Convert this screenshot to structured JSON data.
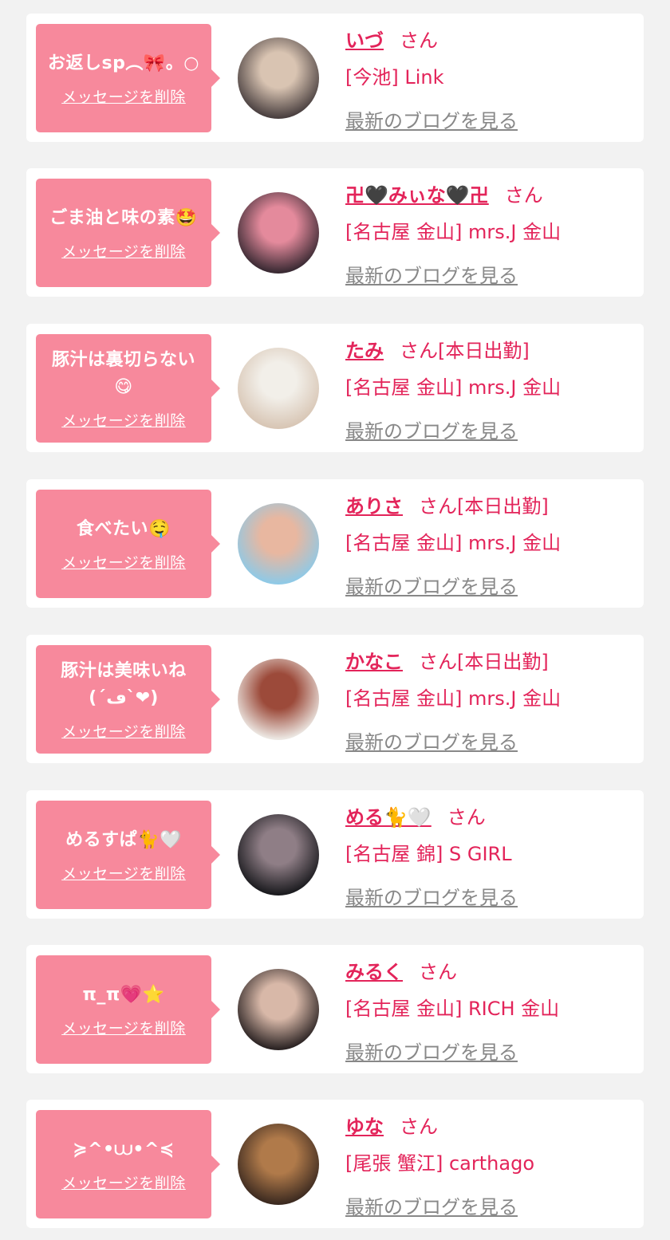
{
  "delete_label": "メッセージを削除",
  "blog_label": "最新のブログを見る",
  "san_label": "さん",
  "cards": [
    {
      "message": "お返しsp︵🎀。○",
      "name": "いづ",
      "suffix": "",
      "shop": "[今池] Link",
      "avatar_colors": [
        "#4a4040",
        "#d9c4b2"
      ]
    },
    {
      "message": "ごま油と味の素🤩",
      "name": "卍🖤みぃな🖤卍",
      "suffix": "",
      "shop": "[名古屋 金山] mrs.J 金山",
      "avatar_colors": [
        "#3a2a33",
        "#e48a9c"
      ]
    },
    {
      "message": "豚汁は裏切らない\n😋",
      "name": "たみ",
      "suffix": "[本日出勤]",
      "shop": "[名古屋 金山] mrs.J 金山",
      "avatar_colors": [
        "#d8c6b5",
        "#f2efe9"
      ]
    },
    {
      "message": "食べたい🤤",
      "name": "ありさ",
      "suffix": "[本日出勤]",
      "shop": "[名古屋 金山] mrs.J 金山",
      "avatar_colors": [
        "#8fc9e6",
        "#e8b7a0"
      ]
    },
    {
      "message": "豚汁は美味いね\n(´ڡ`❤)",
      "name": "かなこ",
      "suffix": "[本日出勤]",
      "shop": "[名古屋 金山] mrs.J 金山",
      "avatar_colors": [
        "#ece7e2",
        "#9c4a3a"
      ]
    },
    {
      "message": "めるすぱ🐈🤍",
      "name": "める🐈🤍",
      "suffix": "",
      "shop": "[名古屋 錦] S GIRL",
      "avatar_colors": [
        "#1b1b1f",
        "#8f7e86"
      ]
    },
    {
      "message": "π_π💗⭐",
      "name": "みるく",
      "suffix": "",
      "shop": "[名古屋 金山] RICH 金山",
      "avatar_colors": [
        "#2c2424",
        "#d8b8a8"
      ]
    },
    {
      "message": "≽^•⩊•^≼",
      "name": "ゆな",
      "suffix": "",
      "shop": "[尾張 蟹江] carthago",
      "avatar_colors": [
        "#3c2a20",
        "#b07a4a"
      ]
    }
  ]
}
